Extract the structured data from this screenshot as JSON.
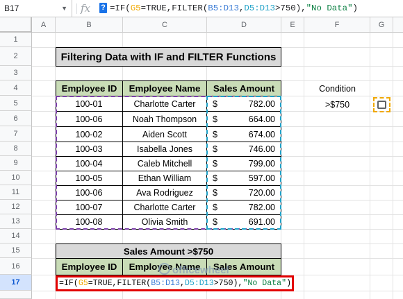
{
  "formula_bar": {
    "cell_ref": "B17",
    "fx": "fx",
    "help": "?",
    "formula_parts": [
      "=IF(",
      "G5",
      "=TRUE,FILTER(",
      "B5:D13",
      ",",
      "D5:D13",
      ">750),",
      "\"No Data\"",
      ")"
    ]
  },
  "columns": [
    "A",
    "B",
    "C",
    "D",
    "E",
    "F",
    "G"
  ],
  "rows": [
    "1",
    "2",
    "3",
    "4",
    "5",
    "6",
    "7",
    "8",
    "9",
    "10",
    "11",
    "12",
    "13",
    "14",
    "15",
    "16",
    "17"
  ],
  "sheet": {
    "title": "Filtering Data with IF and FILTER Functions",
    "headers": [
      "Employee ID",
      "Employee Name",
      "Sales Amount"
    ],
    "records": [
      [
        "100-01",
        "Charlotte Carter",
        "782.00"
      ],
      [
        "100-06",
        "Noah Thompson",
        "664.00"
      ],
      [
        "100-02",
        "Aiden Scott",
        "674.00"
      ],
      [
        "100-03",
        "Isabella Jones",
        "746.00"
      ],
      [
        "100-04",
        "Caleb Mitchell",
        "799.00"
      ],
      [
        "100-05",
        "Ethan William",
        "597.00"
      ],
      [
        "100-06",
        "Ava Rodriguez",
        "720.00"
      ],
      [
        "100-07",
        "Charlotte Carter",
        "782.00"
      ],
      [
        "100-08",
        "Olivia Smith",
        "691.00"
      ]
    ],
    "currency": "$",
    "condition_label": "Condition",
    "condition_value": ">$750",
    "result_title": "Sales Amount >$750",
    "result_headers": [
      "Employee ID",
      "Employee Name",
      "Sales Amount"
    ],
    "watermark": "officewheel"
  },
  "colors": {
    "header_fill": "#c9dcb7",
    "title_fill": "#d9d9d9",
    "highlight": "#e30000",
    "checkbox": "#f0a800"
  }
}
